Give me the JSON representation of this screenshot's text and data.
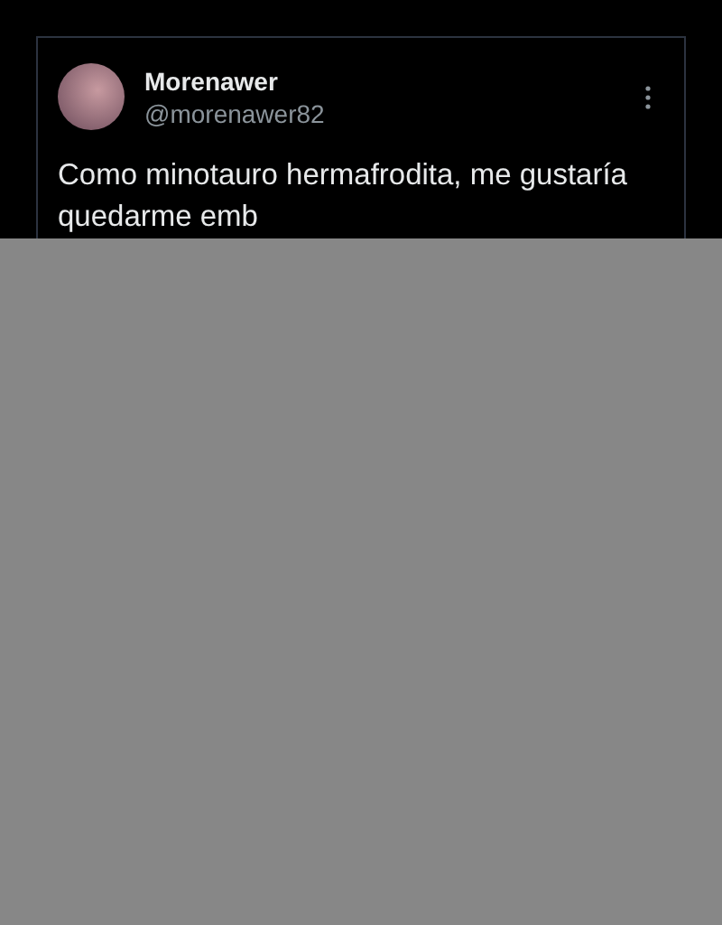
{
  "tweet": {
    "name": "Morenawer",
    "handle": "@morenawer82",
    "text_lines": [
      "Como minotauro hermafrodita, me gustaría",
      "quedarme emb"
    ]
  }
}
